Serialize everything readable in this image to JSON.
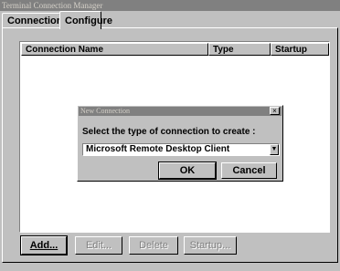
{
  "window": {
    "title": "Terminal Connection Manager"
  },
  "tabs": [
    {
      "label": "Connections",
      "active": false
    },
    {
      "label": "Configure",
      "active": true
    }
  ],
  "list": {
    "columns": [
      "Connection Name",
      "Type",
      "Startup"
    ],
    "rows": []
  },
  "buttons": {
    "add": "Add...",
    "edit": "Edit...",
    "delete": "Delete",
    "startup": "Startup..."
  },
  "dialog": {
    "title": "New Connection",
    "close_glyph": "×",
    "prompt": "Select the type of connection to create :",
    "selected_type": "Microsoft Remote Desktop Client",
    "dropdown_glyph": "▼",
    "ok_label": "OK",
    "cancel_label": "Cancel"
  }
}
